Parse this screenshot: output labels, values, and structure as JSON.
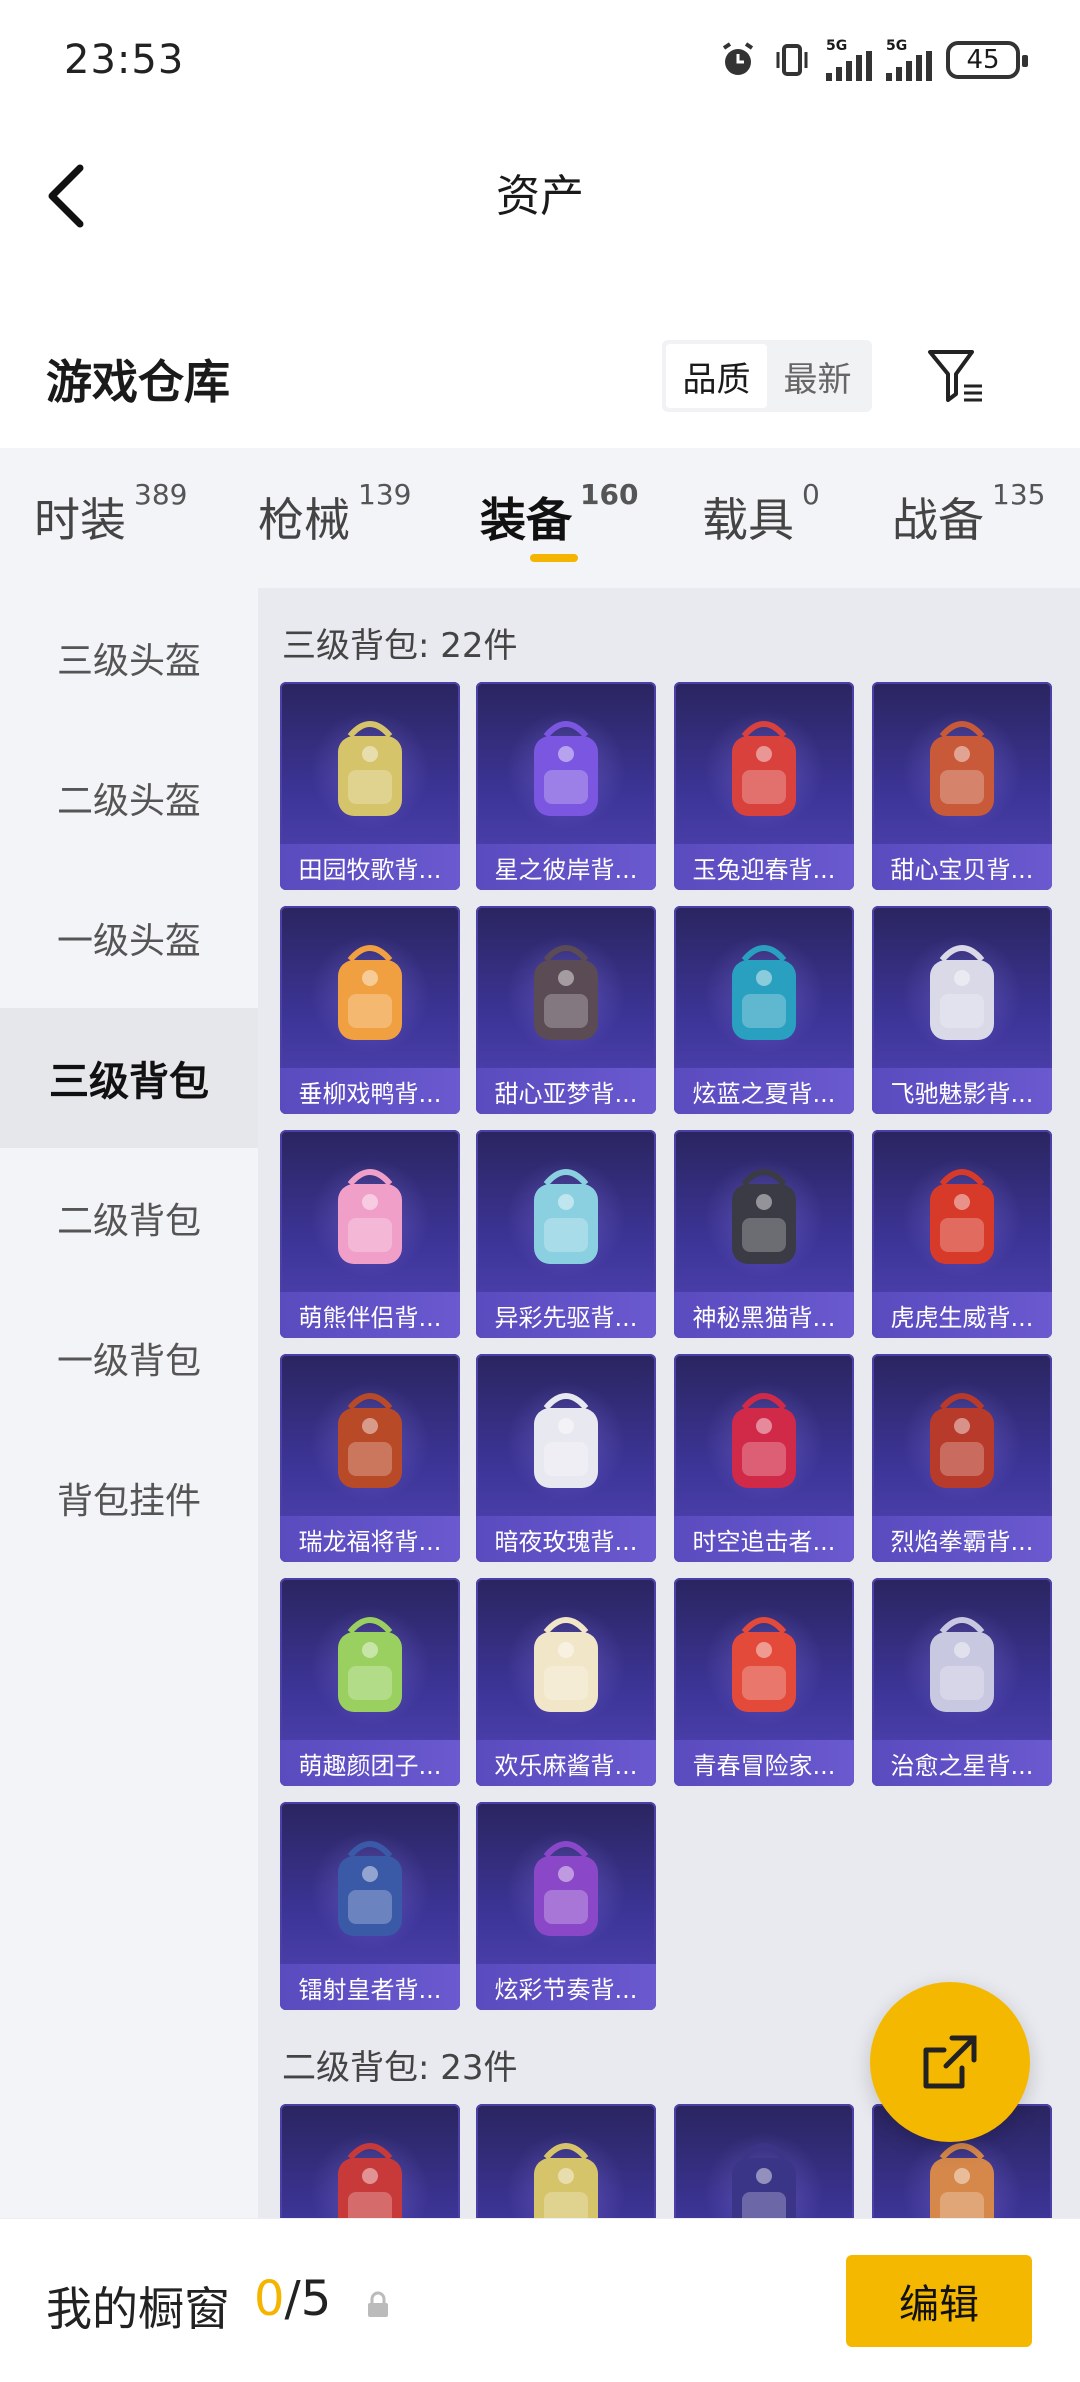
{
  "status_bar": {
    "time": "23:53",
    "battery": "45",
    "net1": "5G",
    "net2": "5G"
  },
  "header": {
    "title": "资产"
  },
  "warehouse": {
    "title": "游戏仓库",
    "sort_options": [
      "品质",
      "最新"
    ],
    "active_sort": "品质"
  },
  "tabs": [
    {
      "label": "时装",
      "count": "389"
    },
    {
      "label": "枪械",
      "count": "139"
    },
    {
      "label": "装备",
      "count": "160"
    },
    {
      "label": "载具",
      "count": "0"
    },
    {
      "label": "战备",
      "count": "135"
    }
  ],
  "active_tab": "装备",
  "sidebar": {
    "items": [
      "三级头盔",
      "二级头盔",
      "一级头盔",
      "三级背包",
      "二级背包",
      "一级背包",
      "背包挂件"
    ],
    "active": "三级背包"
  },
  "sections": [
    {
      "title": "三级背包: 22件",
      "items": [
        "田园牧歌背...",
        "星之彼岸背...",
        "玉兔迎春背...",
        "甜心宝贝背...",
        "垂柳戏鸭背...",
        "甜心亚梦背...",
        "炫蓝之夏背...",
        "飞驰魅影背...",
        "萌熊伴侣背...",
        "异彩先驱背...",
        "神秘黑猫背...",
        "虎虎生威背...",
        "瑞龙福将背...",
        "暗夜玫瑰背...",
        "时空追击者...",
        "烈焰拳霸背...",
        "萌趣颜团子...",
        "欢乐麻酱背...",
        "青春冒险家...",
        "治愈之星背...",
        "镭射皇者背...",
        "炫彩节奏背..."
      ]
    },
    {
      "title": "二级背包: 23件"
    }
  ],
  "item_colors": [
    "#d6c46a",
    "#7b56e0",
    "#d9413d",
    "#c85a3a",
    "#f0a040",
    "#5a4b55",
    "#2aa0c0",
    "#d9d9e8",
    "#f0a0c8",
    "#8ad0e0",
    "#3b3b45",
    "#d83a2a",
    "#b84a28",
    "#e8e8f0",
    "#d02a48",
    "#b83a2a",
    "#9ad060",
    "#f2e6c8",
    "#e34a3a",
    "#c8c8e0",
    "#3a5aa8",
    "#8a48c8"
  ],
  "next_row_colors": [
    "#c83a3a",
    "#d6c46a",
    "#3b3588",
    "#d6884a"
  ],
  "bottom_bar": {
    "label": "我的橱窗",
    "current": "0",
    "total": "/5",
    "edit_label": "编辑"
  },
  "accent_color": "#f5b400"
}
